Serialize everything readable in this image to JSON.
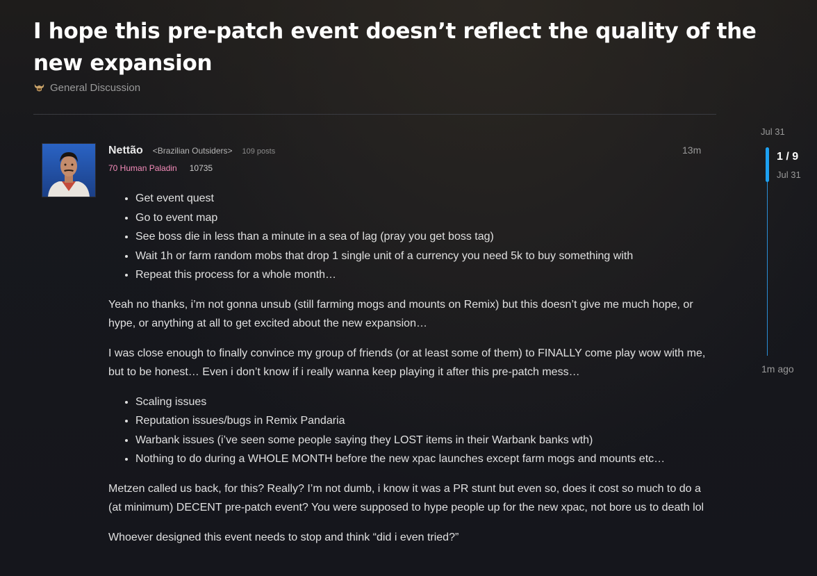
{
  "topic": {
    "title": "I hope this pre-patch event doesn’t reflect the quality of the new expansion",
    "category": "General Discussion",
    "category_icon": "horned-helmet-icon"
  },
  "post": {
    "username": "Nettão",
    "guild": "<Brazilian Outsiders>",
    "post_count": "109 posts",
    "character": "70 Human Paladin",
    "character_color": "#f48cba",
    "achievement_points": "10735",
    "time": "13m",
    "list1": [
      "Get event quest",
      "Go to event map",
      "See boss die in less than a minute in a sea of lag (pray you get boss tag)",
      "Wait 1h or farm random mobs that drop 1 single unit of a currency you need 5k to buy something with",
      "Repeat this process for a whole month…"
    ],
    "para1": "Yeah no thanks, i’m not gonna unsub (still farming mogs and mounts on Remix) but this doesn’t give me much hope, or hype, or anything at all to get excited about the new expansion…",
    "para2": "I was close enough to finally convince my group of friends (or at least some of them) to FINALLY come play wow with me, but to be honest… Even i don’t know if i really wanna keep playing it after this pre-patch mess…",
    "list2": [
      "Scaling issues",
      "Reputation issues/bugs in Remix Pandaria",
      "Warbank issues (i’ve seen some people saying they LOST items in their Warbank banks wth)",
      "Nothing to do during a WHOLE MONTH before the new xpac launches except farm mogs and mounts etc…"
    ],
    "para3": "Metzen called us back, for this? Really? I’m not dumb, i know it was a PR stunt but even so, does it cost so much to do a (at minimum) DECENT pre-patch event? You were supposed to hype people up for the new xpac, not bore us to death lol",
    "para4": "Whoever designed this event needs to stop and think “did i even tried?”"
  },
  "timeline": {
    "start_date": "Jul 31",
    "position": "1 / 9",
    "position_date": "Jul 31",
    "end_label": "1m ago",
    "accent": "#1da1f2"
  }
}
